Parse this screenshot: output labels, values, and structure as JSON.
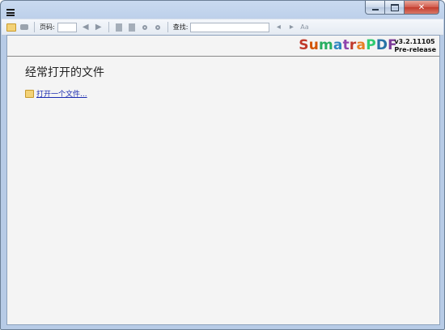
{
  "window": {
    "menu_icon": "hamburger-menu-icon",
    "caption": {
      "minimize_icon": "minimize-icon",
      "maximize_icon": "maximize-icon",
      "close_icon": "close-icon",
      "close_glyph": "✕"
    }
  },
  "toolbar": {
    "page_label": "页码:",
    "page_value": "",
    "find_label": "查找:",
    "find_value": "",
    "glyphs": {
      "prev": "◀",
      "next": "▶",
      "find_prev": "◂",
      "find_next": "▸",
      "match_case": "Aa"
    }
  },
  "brand": {
    "name_parts": [
      "S",
      "u",
      "m",
      "a",
      "t",
      "r",
      "a",
      "P",
      "D",
      "F"
    ],
    "version_line1": "v3.2.11105",
    "version_line2": "Pre-release"
  },
  "main": {
    "heading": "经常打开的文件",
    "open_link": "打开一个文件..."
  }
}
